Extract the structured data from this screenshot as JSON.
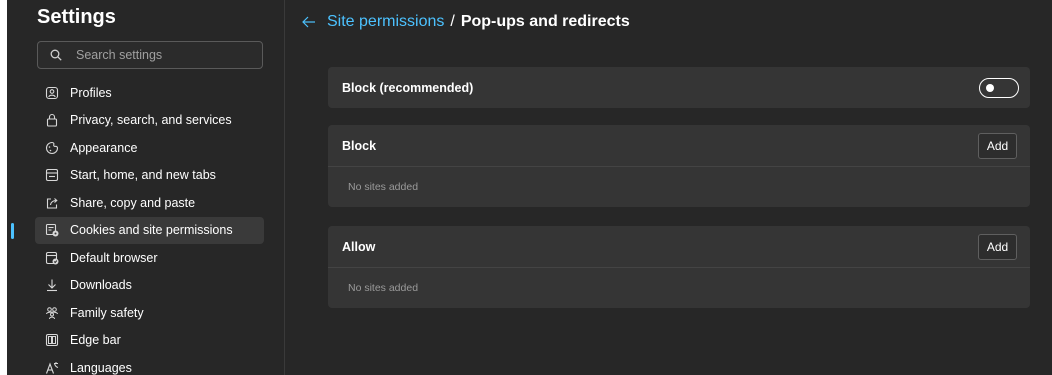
{
  "sidebar": {
    "title": "Settings",
    "search": {
      "placeholder": "Search settings",
      "icon": "search-icon"
    },
    "items": [
      {
        "label": "Profiles",
        "icon": "profile-icon",
        "active": false
      },
      {
        "label": "Privacy, search, and services",
        "icon": "lock-icon",
        "active": false
      },
      {
        "label": "Appearance",
        "icon": "appearance-icon",
        "active": false
      },
      {
        "label": "Start, home, and new tabs",
        "icon": "home-tabs-icon",
        "active": false
      },
      {
        "label": "Share, copy and paste",
        "icon": "share-icon",
        "active": false
      },
      {
        "label": "Cookies and site permissions",
        "icon": "cookies-permissions-icon",
        "active": true
      },
      {
        "label": "Default browser",
        "icon": "default-browser-icon",
        "active": false
      },
      {
        "label": "Downloads",
        "icon": "download-icon",
        "active": false
      },
      {
        "label": "Family safety",
        "icon": "family-icon",
        "active": false
      },
      {
        "label": "Edge bar",
        "icon": "edge-bar-icon",
        "active": false
      },
      {
        "label": "Languages",
        "icon": "languages-icon",
        "active": false
      }
    ]
  },
  "breadcrumb": {
    "parent": "Site permissions",
    "separator": "/",
    "current": "Pop-ups and redirects"
  },
  "block_recommended": {
    "label": "Block (recommended)",
    "toggle_on": false
  },
  "block_section": {
    "title": "Block",
    "add_label": "Add",
    "empty_text": "No sites added"
  },
  "allow_section": {
    "title": "Allow",
    "add_label": "Add",
    "empty_text": "No sites added"
  },
  "colors": {
    "accent": "#4cc2ff",
    "background": "#272727",
    "card": "#353535"
  }
}
